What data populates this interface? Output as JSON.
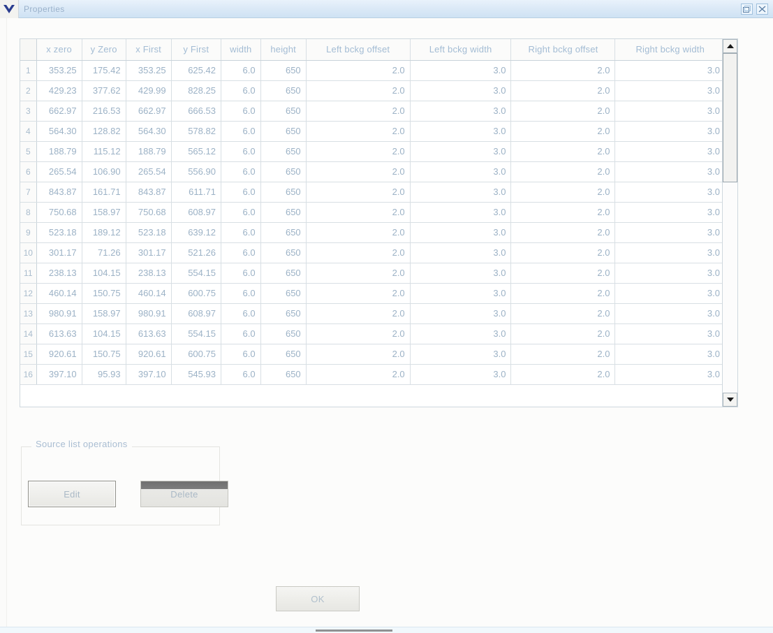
{
  "window": {
    "title": "Properties",
    "icon": "app-icon",
    "buttons": [
      {
        "name": "restore-button",
        "glyph": "restore-icon"
      },
      {
        "name": "close-button",
        "glyph": "close-icon"
      }
    ]
  },
  "table": {
    "columns": [
      "",
      "x zero",
      "y Zero",
      "x First",
      "y First",
      "width",
      "height",
      "Left bckg offset",
      "Left bckg width",
      "Right bckg offset",
      "Right bckg width"
    ],
    "rows": [
      [
        "1",
        "353.25",
        "175.42",
        "353.25",
        "625.42",
        "6.0",
        "650",
        "2.0",
        "3.0",
        "2.0",
        "3.0"
      ],
      [
        "2",
        "429.23",
        "377.62",
        "429.99",
        "828.25",
        "6.0",
        "650",
        "2.0",
        "3.0",
        "2.0",
        "3.0"
      ],
      [
        "3",
        "662.97",
        "216.53",
        "662.97",
        "666.53",
        "6.0",
        "650",
        "2.0",
        "3.0",
        "2.0",
        "3.0"
      ],
      [
        "4",
        "564.30",
        "128.82",
        "564.30",
        "578.82",
        "6.0",
        "650",
        "2.0",
        "3.0",
        "2.0",
        "3.0"
      ],
      [
        "5",
        "188.79",
        "115.12",
        "188.79",
        "565.12",
        "6.0",
        "650",
        "2.0",
        "3.0",
        "2.0",
        "3.0"
      ],
      [
        "6",
        "265.54",
        "106.90",
        "265.54",
        "556.90",
        "6.0",
        "650",
        "2.0",
        "3.0",
        "2.0",
        "3.0"
      ],
      [
        "7",
        "843.87",
        "161.71",
        "843.87",
        "611.71",
        "6.0",
        "650",
        "2.0",
        "3.0",
        "2.0",
        "3.0"
      ],
      [
        "8",
        "750.68",
        "158.97",
        "750.68",
        "608.97",
        "6.0",
        "650",
        "2.0",
        "3.0",
        "2.0",
        "3.0"
      ],
      [
        "9",
        "523.18",
        "189.12",
        "523.18",
        "639.12",
        "6.0",
        "650",
        "2.0",
        "3.0",
        "2.0",
        "3.0"
      ],
      [
        "10",
        "301.17",
        "71.26",
        "301.17",
        "521.26",
        "6.0",
        "650",
        "2.0",
        "3.0",
        "2.0",
        "3.0"
      ],
      [
        "11",
        "238.13",
        "104.15",
        "238.13",
        "554.15",
        "6.0",
        "650",
        "2.0",
        "3.0",
        "2.0",
        "3.0"
      ],
      [
        "12",
        "460.14",
        "150.75",
        "460.14",
        "600.75",
        "6.0",
        "650",
        "2.0",
        "3.0",
        "2.0",
        "3.0"
      ],
      [
        "13",
        "980.91",
        "158.97",
        "980.91",
        "608.97",
        "6.0",
        "650",
        "2.0",
        "3.0",
        "2.0",
        "3.0"
      ],
      [
        "14",
        "613.63",
        "104.15",
        "613.63",
        "554.15",
        "6.0",
        "650",
        "2.0",
        "3.0",
        "2.0",
        "3.0"
      ],
      [
        "15",
        "920.61",
        "150.75",
        "920.61",
        "600.75",
        "6.0",
        "650",
        "2.0",
        "3.0",
        "2.0",
        "3.0"
      ],
      [
        "16",
        "397.10",
        "95.93",
        "397.10",
        "545.93",
        "6.0",
        "650",
        "2.0",
        "3.0",
        "2.0",
        "3.0"
      ]
    ]
  },
  "scrollbar": {
    "up_arrow": "scroll-up-icon",
    "down_arrow": "scroll-down-icon",
    "thumb_percent": 38
  },
  "group": {
    "title": "Source list operations",
    "edit_label": "Edit",
    "delete_label": "Delete"
  },
  "footer": {
    "ok_label": "OK"
  },
  "colors": {
    "titlebar_start": "#e9f2fb",
    "titlebar_end": "#cfe2f4",
    "text_muted": "#9fb3c8",
    "border": "#cfd8de",
    "button_face": "#efefec"
  }
}
